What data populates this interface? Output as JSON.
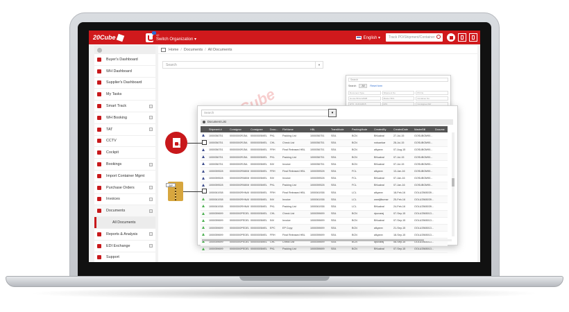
{
  "header": {
    "logo_text": "20Cube",
    "org_badge_count": "42",
    "org_label": "Switch Organization ▾",
    "language": "English ▾",
    "track_placeholder": "Track PO/Shipment/Container"
  },
  "sidebar": {
    "items": [
      {
        "label": "Buyer's Dashboard",
        "has_expander": false
      },
      {
        "label": "WH Dashboard",
        "has_expander": false
      },
      {
        "label": "Supplier's Dashboard",
        "has_expander": false
      },
      {
        "label": "My Tasks",
        "has_expander": false
      },
      {
        "label": "Smart Track",
        "has_expander": true
      },
      {
        "label": "WH Booking",
        "has_expander": true
      },
      {
        "label": "TAT",
        "has_expander": true
      },
      {
        "label": "CCTV",
        "has_expander": false
      },
      {
        "label": "Cockpit",
        "has_expander": false
      },
      {
        "label": "Bookings",
        "has_expander": true
      },
      {
        "label": "Import Container Mgmt",
        "has_expander": false
      },
      {
        "label": "Purchase Orders",
        "has_expander": true
      },
      {
        "label": "Invoices",
        "has_expander": true
      },
      {
        "label": "Documents",
        "has_expander": true
      },
      {
        "label": "All Documents",
        "sub": true
      },
      {
        "label": "Reports & Analysis",
        "has_expander": true
      },
      {
        "label": "EDI Exchange",
        "has_expander": true
      },
      {
        "label": "Support",
        "has_expander": false
      }
    ]
  },
  "breadcrumb": [
    "Home",
    "Documents",
    "All Documents"
  ],
  "main_search_placeholder": "Search",
  "search_panel": {
    "search_placeholder": "Search",
    "search_label": "Search",
    "tab_all": "All",
    "advanced_link": "Reset form",
    "fields": [
      "Document Type",
      "Shipment No",
      "PO No",
      "House BOL/HAWB",
      "Master BOL",
      "Container No",
      "ETD : 01/01/2015",
      "ETA",
      "Consignee Ref",
      "Supplier",
      "",
      ""
    ],
    "button": "Search"
  },
  "doc_panel": {
    "search_placeholder": "Search",
    "title": "Document List",
    "columns": [
      "",
      "Shipment #",
      "Consignor",
      "Consignee",
      "Docu...",
      "FileName",
      "HBL",
      "TransMode",
      "PackingMode",
      "CreatedBy",
      "CreatedDate",
      "MasterBill",
      "Docume"
    ],
    "rows": [
      {
        "icon": "blue",
        "cells": [
          "1000056751",
          "00000000RJ5A",
          "00000005MEL",
          "PKL",
          "Packing List",
          "1000056751",
          "SEA",
          "BCN",
          "BKsakral",
          "27-Jul-15",
          "GOSUBOM90..."
        ]
      },
      {
        "icon": "blue",
        "cells": [
          "1000056751",
          "00000000RJ5A",
          "00000005MEL",
          "CHL",
          "Check List",
          "1000056751",
          "SEA",
          "BCN",
          "notuankar",
          "28-Jul-15",
          "GOSUBOM90..."
        ]
      },
      {
        "icon": "blue",
        "cells": [
          "1000056751",
          "00000000RJ5A",
          "00000005MEL",
          "FRH",
          "Final Released HBL",
          "1000056751",
          "SEA",
          "BCN",
          "alkyann",
          "07-Aug-15",
          "GOSUBOM90..."
        ]
      },
      {
        "icon": "blue",
        "cells": [
          "1000056751",
          "00000000RJ5A",
          "00000005MEL",
          "PKL",
          "Packing List",
          "1000056751",
          "SEA",
          "BCN",
          "BKsakral",
          "07-Jul-15",
          "GOSUBOM90..."
        ]
      },
      {
        "icon": "blue",
        "cells": [
          "1000056751",
          "00000000RJ5A",
          "00000005MEL",
          "INV",
          "Invoice",
          "1000056751",
          "SEA",
          "BCN",
          "BKsakral",
          "07-Jul-15",
          "GOSUBOM90..."
        ]
      },
      {
        "icon": "blue",
        "cells": [
          "1000059528",
          "00000000R080M",
          "00000005MEL",
          "FRH",
          "Final Released HBL",
          "1000059528",
          "SEA",
          "FCL",
          "alkyann",
          "13-Jan-16",
          "GOSUBOM90..."
        ]
      },
      {
        "icon": "blue",
        "cells": [
          "1000059528",
          "00000000R080M",
          "00000005MEL",
          "INV",
          "Invoice",
          "1000059528",
          "SEA",
          "FCL",
          "BKsakral",
          "07-Jan-16",
          "GOSUBOM90..."
        ]
      },
      {
        "icon": "blue",
        "cells": [
          "1000059528",
          "00000000R080M",
          "00000005MEL",
          "PKL",
          "Packing List",
          "1000059528",
          "SEA",
          "FCL",
          "BKsakral",
          "07-Jan-16",
          "GOSUBOM90..."
        ]
      },
      {
        "icon": "green",
        "cells": [
          "1000061938",
          "00000000RHNAR",
          "00000005MEL",
          "FRH",
          "Final Released HBL",
          "1000061938",
          "SEA",
          "LCL",
          "alkyann",
          "18-Feb-16",
          "OOLU2565039..."
        ]
      },
      {
        "icon": "green",
        "cells": [
          "1000061938",
          "00000000RHNAR",
          "00000005MEL",
          "INV",
          "Invoice",
          "1000061938",
          "SEA",
          "LCL",
          "wardjilkumar",
          "25-Feb-16",
          "OOLU2565039..."
        ]
      },
      {
        "icon": "green",
        "cells": [
          "1000061938",
          "00000000RHNAR",
          "00000005MEL",
          "PKL",
          "Packing List",
          "1000061938",
          "SEA",
          "LCL",
          "BKsakral",
          "24-Feb-16",
          "OOLU2565039..."
        ]
      },
      {
        "icon": "green",
        "cells": [
          "1000059699",
          "00000000PEDEL",
          "00000005MEL",
          "CHL",
          "Check List",
          "1000059699",
          "SEA",
          "BCN",
          "dpuvaraj",
          "07-Sep-15",
          "OOLU2565013..."
        ]
      },
      {
        "icon": "green",
        "cells": [
          "1000059699",
          "00000000PEDEL",
          "00000005MEL",
          "INV",
          "Invoice",
          "1000059699",
          "SEA",
          "BCN",
          "BKsakral",
          "07-Sep-15",
          "OOLU2565013..."
        ]
      },
      {
        "icon": "green",
        "cells": [
          "1000059699",
          "00000000PEDEL",
          "00000005MEL",
          "EPC",
          "EP Copy",
          "1000059699",
          "SEA",
          "BCN",
          "alkyann",
          "21-Sep-15",
          "OOLU2565013..."
        ]
      },
      {
        "icon": "green",
        "cells": [
          "1000059699",
          "00000000PEDEL",
          "00000005MEL",
          "FRH",
          "Final Released HBL",
          "1000059699",
          "SEA",
          "BCN",
          "alkyann",
          "18-Sep-15",
          "OOLU2565013..."
        ]
      },
      {
        "icon": "green",
        "cells": [
          "1000059699",
          "00000000PEDEL",
          "00000005MEL",
          "CHL",
          "Check List",
          "1000059699",
          "SEA",
          "BCN",
          "dpuvaraj",
          "08-Sep-15",
          "OOLU2565013..."
        ]
      },
      {
        "icon": "green",
        "cells": [
          "1000059699",
          "00000000PEDEL",
          "00000005MEL",
          "PKL",
          "Packing List",
          "1000059699",
          "SEA",
          "BCN",
          "BKsakral",
          "07-Sep-15",
          "OOLU2565013..."
        ]
      }
    ]
  },
  "export": {
    "pdf_label": "PDF",
    "zip_label": "ZIP"
  },
  "watermark": "20Cube",
  "colors": {
    "brand_red": "#d0191c",
    "header_dark": "#555555",
    "blue_icon": "#3a4a8a",
    "green_icon": "#4caf50",
    "zip_gold": "#d7a63e"
  }
}
